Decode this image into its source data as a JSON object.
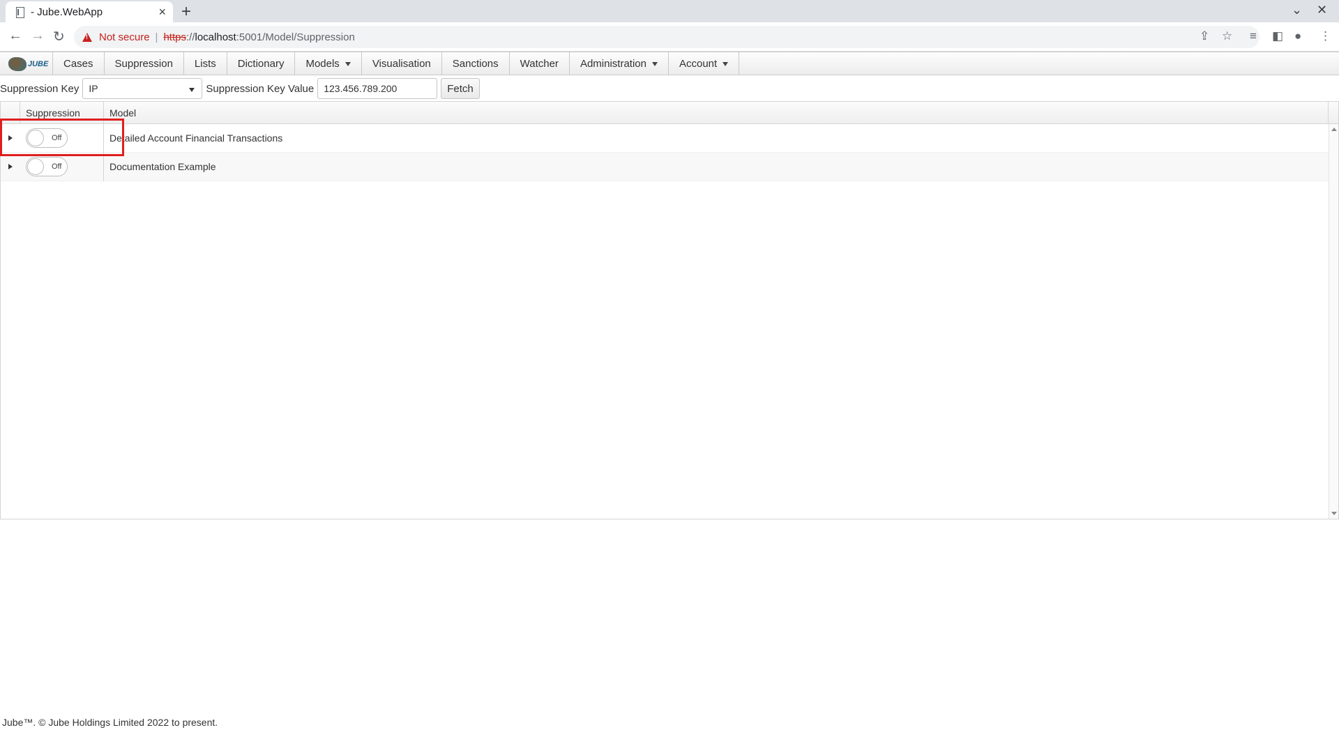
{
  "browser": {
    "tab_title": "- Jube.WebApp",
    "tab_close": "×",
    "new_tab": "+",
    "not_secure": "Not secure",
    "url_scheme": "https",
    "url_sep": "://",
    "url_host": "localhost",
    "url_path": ":5001/Model/Suppression"
  },
  "menu": {
    "logo_text": "JUBE",
    "items": [
      {
        "label": "Cases",
        "dropdown": false
      },
      {
        "label": "Suppression",
        "dropdown": false
      },
      {
        "label": "Lists",
        "dropdown": false
      },
      {
        "label": "Dictionary",
        "dropdown": false
      },
      {
        "label": "Models",
        "dropdown": true
      },
      {
        "label": "Visualisation",
        "dropdown": false
      },
      {
        "label": "Sanctions",
        "dropdown": false
      },
      {
        "label": "Watcher",
        "dropdown": false
      },
      {
        "label": "Administration",
        "dropdown": true
      },
      {
        "label": "Account",
        "dropdown": true
      }
    ]
  },
  "filter": {
    "key_label": "Suppression Key",
    "key_value": "IP",
    "value_label": "Suppression Key Value",
    "value_input": "123.456.789.200",
    "fetch_label": "Fetch"
  },
  "grid": {
    "columns": [
      "Suppression",
      "Model"
    ],
    "rows": [
      {
        "toggle": "Off",
        "model": "Detailed Account Financial Transactions"
      },
      {
        "toggle": "Off",
        "model": "Documentation Example"
      }
    ]
  },
  "footer": "Jube™. © Jube Holdings Limited 2022 to present.",
  "colors": {
    "highlight": "#e01e1e",
    "not_secure": "#c5221f"
  }
}
